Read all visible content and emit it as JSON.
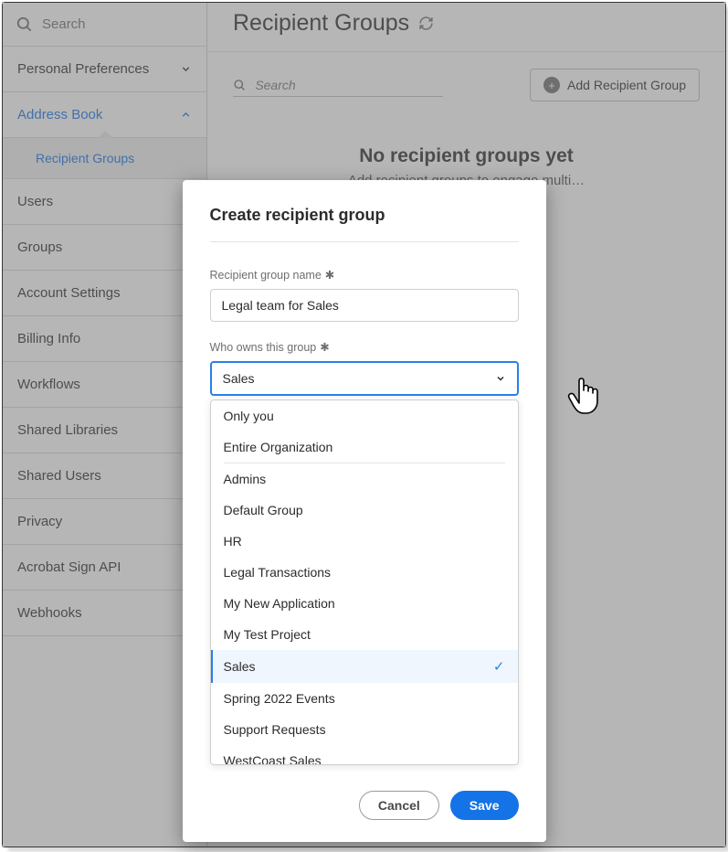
{
  "sidebar": {
    "search_placeholder": "Search",
    "items": [
      {
        "label": "Personal Preferences",
        "expandable": true,
        "open": false
      },
      {
        "label": "Address Book",
        "expandable": true,
        "open": true,
        "children": [
          {
            "label": "Recipient Groups"
          }
        ]
      },
      {
        "label": "Users",
        "expandable": false
      },
      {
        "label": "Groups",
        "expandable": false
      },
      {
        "label": "Account Settings",
        "expandable": true,
        "open": false
      },
      {
        "label": "Billing Info",
        "expandable": true,
        "open": false
      },
      {
        "label": "Workflows",
        "expandable": false
      },
      {
        "label": "Shared Libraries",
        "expandable": false
      },
      {
        "label": "Shared Users",
        "expandable": false
      },
      {
        "label": "Privacy",
        "expandable": false
      },
      {
        "label": "Acrobat Sign API",
        "expandable": true,
        "open": false
      },
      {
        "label": "Webhooks",
        "expandable": false
      }
    ]
  },
  "page": {
    "title": "Recipient Groups",
    "search_placeholder": "Search",
    "add_button": "Add Recipient Group",
    "empty_heading": "No recipient groups yet",
    "empty_sub": "Add recipient groups to engage multi…"
  },
  "modal": {
    "title": "Create recipient group",
    "name_label": "Recipient group name",
    "name_value": "Legal team for Sales",
    "owner_label": "Who owns this group",
    "owner_value": "Sales",
    "dropdown_groups": [
      [
        "Only you",
        "Entire Organization"
      ],
      [
        "Admins",
        "Default Group",
        "HR",
        "Legal Transactions",
        "My New Application",
        "My Test Project",
        "Sales",
        "Spring 2022 Events",
        "Support Requests",
        "WestCoast Sales"
      ]
    ],
    "selected": "Sales",
    "cancel": "Cancel",
    "save": "Save"
  }
}
